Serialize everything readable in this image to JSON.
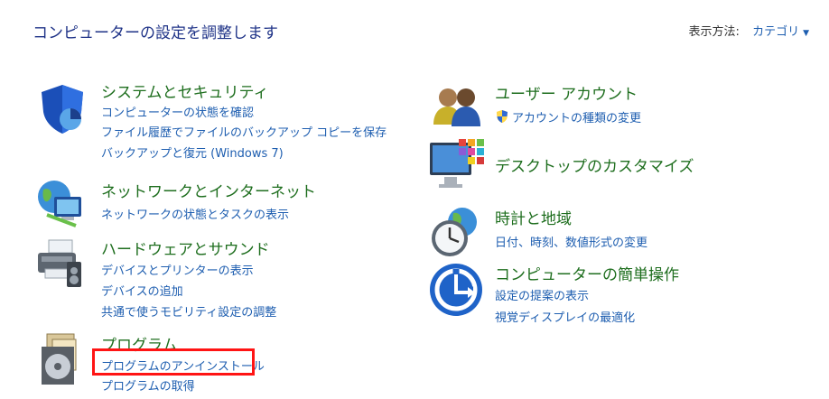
{
  "header": {
    "title": "コンピューターの設定を調整します",
    "view_by_label": "表示方法:",
    "view_by_value": "カテゴリ"
  },
  "categories": {
    "security": {
      "title": "システムとセキュリティ",
      "links": [
        "コンピューターの状態を確認",
        "ファイル履歴でファイルのバックアップ コピーを保存",
        "バックアップと復元 (Windows 7)"
      ]
    },
    "network": {
      "title": "ネットワークとインターネット",
      "links": [
        "ネットワークの状態とタスクの表示"
      ]
    },
    "hardware": {
      "title": "ハードウェアとサウンド",
      "links": [
        "デバイスとプリンターの表示",
        "デバイスの追加",
        "共通で使うモビリティ設定の調整"
      ]
    },
    "programs": {
      "title": "プログラム",
      "links": [
        "プログラムのアンインストール",
        "プログラムの取得"
      ]
    },
    "user": {
      "title": "ユーザー アカウント",
      "links": [
        "アカウントの種類の変更"
      ]
    },
    "desktop": {
      "title": "デスクトップのカスタマイズ",
      "links": []
    },
    "clock": {
      "title": "時計と地域",
      "links": [
        "日付、時刻、数値形式の変更"
      ]
    },
    "ease": {
      "title": "コンピューターの簡単操作",
      "links": [
        "設定の提案の表示",
        "視覚ディスプレイの最適化"
      ]
    }
  }
}
